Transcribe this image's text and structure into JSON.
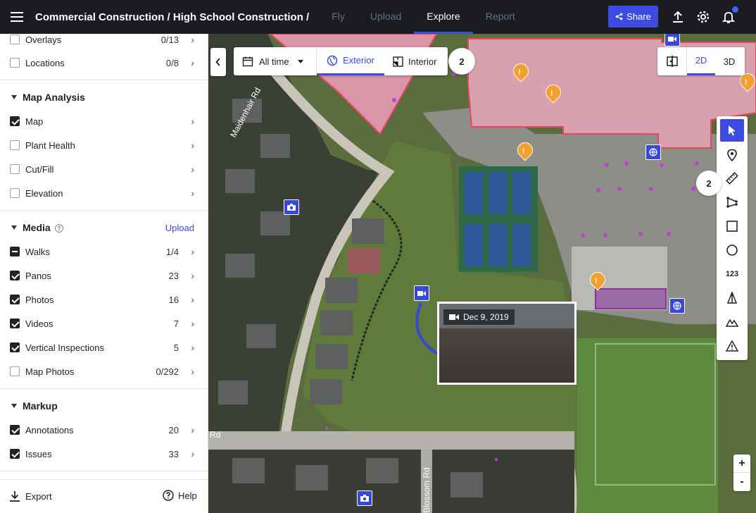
{
  "header": {
    "breadcrumb": "Commercial Construction / High School Construction /",
    "tabs": [
      {
        "label": "Fly"
      },
      {
        "label": "Upload"
      },
      {
        "label": "Explore"
      },
      {
        "label": "Report"
      }
    ],
    "share_label": "Share"
  },
  "sidebar": {
    "top_items": [
      {
        "label": "Overlays",
        "count": "0/13"
      },
      {
        "label": "Locations",
        "count": "0/8"
      }
    ],
    "map_analysis": {
      "title": "Map Analysis",
      "items": [
        {
          "label": "Map",
          "count": ""
        },
        {
          "label": "Plant Health",
          "count": ""
        },
        {
          "label": "Cut/Fill",
          "count": ""
        },
        {
          "label": "Elevation",
          "count": ""
        }
      ]
    },
    "media": {
      "title": "Media",
      "upload_label": "Upload",
      "info_glyph": "?",
      "items": [
        {
          "label": "Walks",
          "count": "1/4"
        },
        {
          "label": "Panos",
          "count": "23"
        },
        {
          "label": "Photos",
          "count": "16"
        },
        {
          "label": "Videos",
          "count": "7"
        },
        {
          "label": "Vertical Inspections",
          "count": "5"
        },
        {
          "label": "Map Photos",
          "count": "0/292"
        }
      ]
    },
    "markup": {
      "title": "Markup",
      "items": [
        {
          "label": "Annotations",
          "count": "20"
        },
        {
          "label": "Issues",
          "count": "33"
        }
      ]
    },
    "footer": {
      "export_label": "Export",
      "help_label": "Help"
    }
  },
  "map_toolbar": {
    "time_filter": "All time",
    "exterior_label": "Exterior",
    "interior_label": "Interior",
    "floor_count": "2",
    "view_2d": "2D",
    "view_3d": "3D",
    "side_badge": "2",
    "number_tool": "123",
    "zoom_in": "+",
    "zoom_out": "-"
  },
  "map": {
    "video_popup_date": "Dec 9, 2019",
    "roads": [
      {
        "label": "Maidenhair Rd"
      },
      {
        "label": "Rd"
      },
      {
        "label": "Blossom Rd"
      }
    ]
  },
  "colors": {
    "accent": "#3d4be0",
    "topbar": "#1a1c21",
    "warning": "#f2a12e",
    "building_highlight": "#e8485f"
  }
}
